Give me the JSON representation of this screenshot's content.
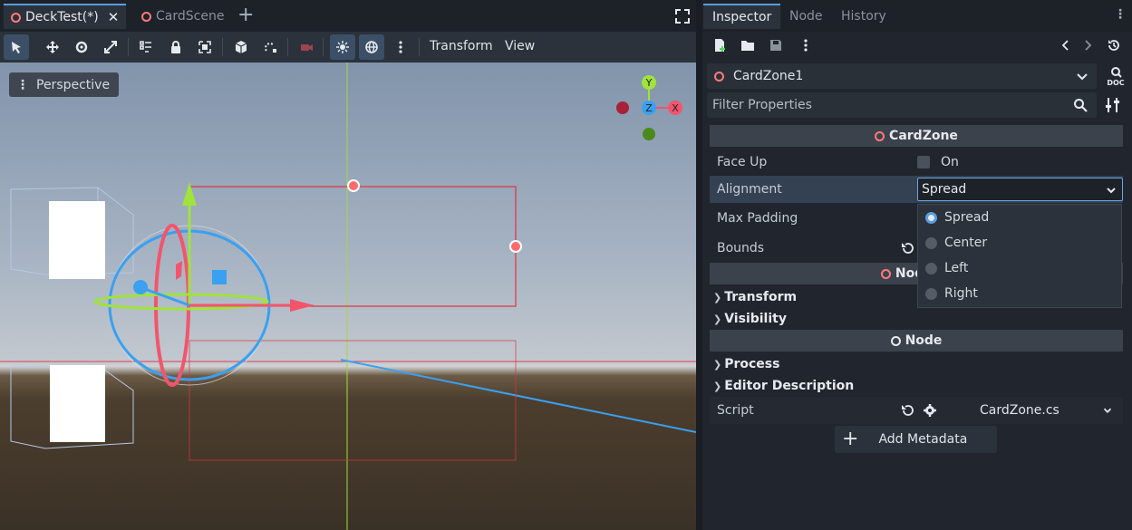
{
  "scene_tabs": [
    {
      "label": "DeckTest(*)",
      "close": "✕"
    },
    {
      "label": "CardScene"
    }
  ],
  "add_tab_icon": "+",
  "toolbar": {
    "transform_menu": "Transform",
    "view_menu": "View"
  },
  "viewport": {
    "perspective_label": "Perspective",
    "gizmo": {
      "y": "Y",
      "z": "Z",
      "x": "X"
    }
  },
  "dock_tabs": [
    "Inspector",
    "Node",
    "History"
  ],
  "inspector": {
    "node_name": "CardZone1",
    "doc_label": "DOC",
    "filter_placeholder": "Filter Properties",
    "sections": {
      "cardzone": "CardZone",
      "node3d": "Node3D",
      "node": "Node"
    },
    "props": {
      "face_up": {
        "label": "Face Up",
        "value": "On"
      },
      "alignment": {
        "label": "Alignment",
        "value": "Spread"
      },
      "max_padding": {
        "label": "Max Padding"
      },
      "bounds": {
        "label": "Bounds"
      },
      "script": {
        "label": "Script",
        "value": "CardZone.cs"
      }
    },
    "groups": {
      "transform": "Transform",
      "visibility": "Visibility",
      "process": "Process",
      "editor_description": "Editor Description"
    },
    "add_metadata": "Add Metadata"
  },
  "alignment_options": [
    "Spread",
    "Center",
    "Left",
    "Right"
  ],
  "colors": {
    "accent": "#5a9ddf",
    "node_ring": "#ff7a7a",
    "axis_x": "#f2556b",
    "axis_y": "#a0e33a",
    "axis_z": "#3aa0f0"
  }
}
